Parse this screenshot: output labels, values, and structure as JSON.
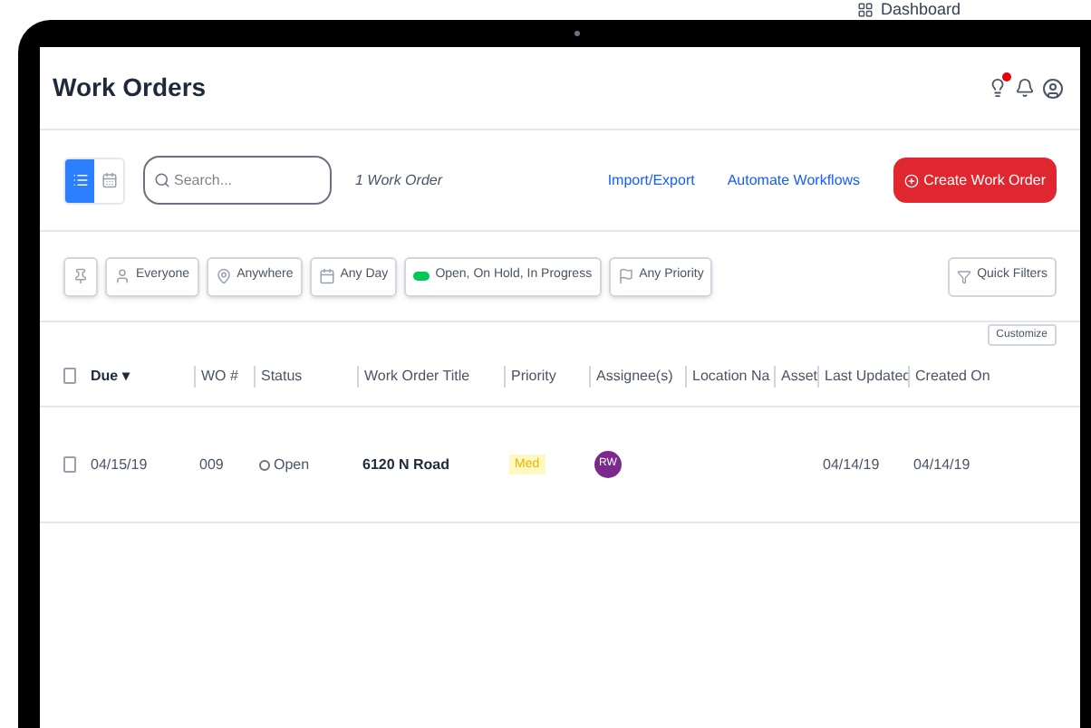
{
  "topbar": {
    "label": "Dashboard"
  },
  "header": {
    "title": "Work Orders"
  },
  "toolbar": {
    "views": [
      {
        "kind": "list",
        "selected": true
      },
      {
        "kind": "calendar",
        "selected": false
      }
    ],
    "search": {
      "placeholder": "Search..."
    },
    "count": "1 Work Order",
    "links": [
      "Import/Export",
      "Automate Workflows"
    ],
    "create_button": "Create Work Order"
  },
  "filters": [
    {
      "kind": "pin"
    },
    {
      "kind": "person",
      "label": "Everyone"
    },
    {
      "kind": "location",
      "label": "Anywhere"
    },
    {
      "kind": "calendar",
      "label": "Any Day"
    },
    {
      "kind": "status",
      "label": "Open, On Hold, In Progress"
    },
    {
      "kind": "priority",
      "label": "Any Priority"
    }
  ],
  "quick_filters": "Quick Filters",
  "customize": "Customize",
  "table": {
    "columns": [
      "Due",
      "WO #",
      "Status",
      "Work Order Title",
      "Priority",
      "Assignee(s)",
      "Location Na",
      "Asset",
      "Last Updated",
      "Created On"
    ],
    "sort_mark": "▾",
    "all_checked": false,
    "rows": [
      {
        "checked": false,
        "due": "04/15/19",
        "wo": "009",
        "status": "Open",
        "title": "6120 N Road",
        "priority": "Med",
        "assignee": "RW",
        "color": "#7b2a8c",
        "last_updated": "04/14/19",
        "created_on": "04/14/19"
      }
    ]
  }
}
